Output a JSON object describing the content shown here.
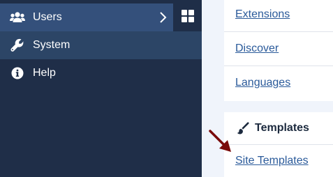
{
  "sidebar": {
    "items": [
      {
        "label": "Users",
        "icon": "users-icon"
      },
      {
        "label": "System",
        "icon": "wrench-icon"
      },
      {
        "label": "Help",
        "icon": "info-icon"
      }
    ],
    "dashboard_icon": "grid-icon"
  },
  "content": {
    "links": [
      "Extensions",
      "Discover",
      "Languages"
    ],
    "templates_card": {
      "title": "Templates",
      "icon": "paint-brush-icon",
      "links": [
        "Site Templates"
      ]
    }
  },
  "annotation": {
    "icon": "red-arrow-icon",
    "color": "#7a0a0a"
  },
  "colors": {
    "sidebar_bg": "#1f2e48",
    "active_item_bg": "#34507b",
    "hover_item_bg": "#2c4566",
    "link": "#2a5a9a",
    "page_bg": "#f0f4fb"
  }
}
